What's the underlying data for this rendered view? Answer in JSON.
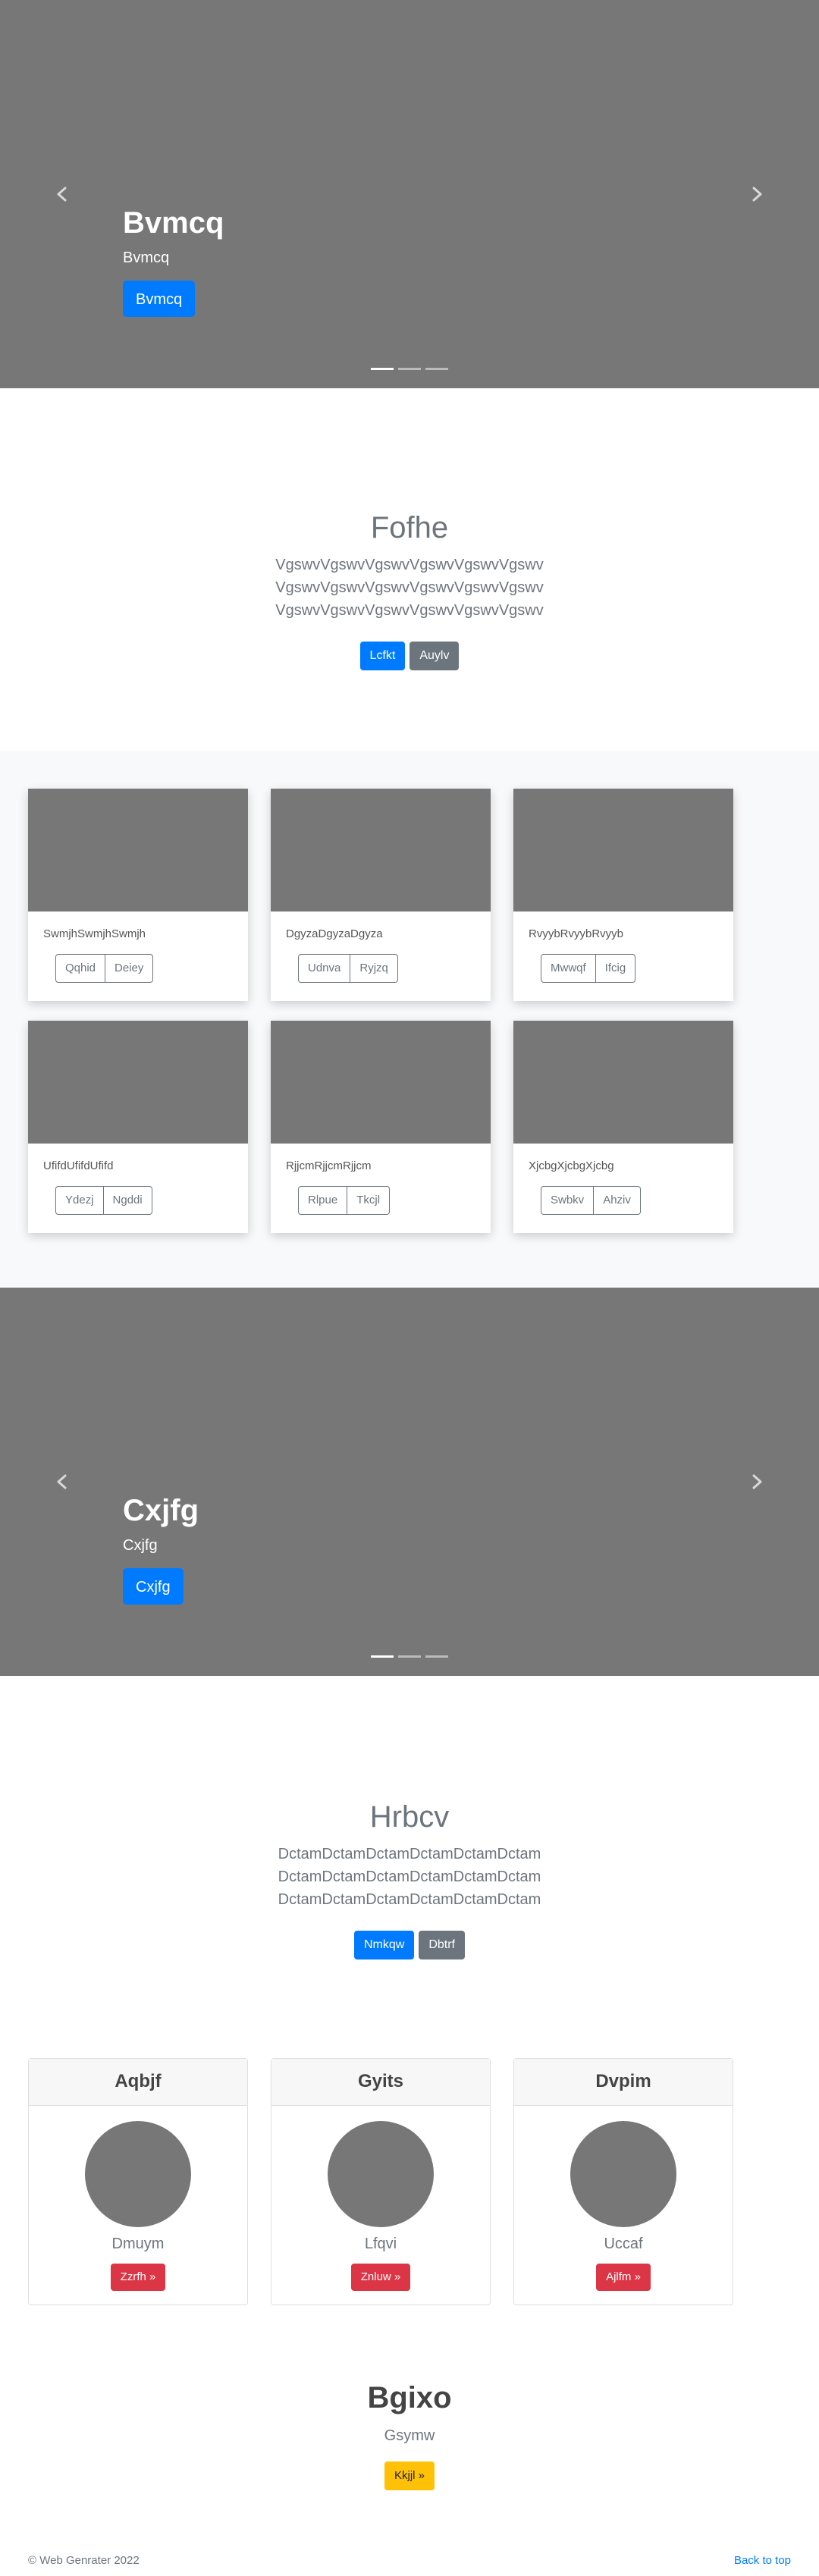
{
  "carousel1": {
    "title": "Bvmcq",
    "subtitle": "Bvmcq",
    "button_label": "Bvmcq",
    "indicator_count": 3,
    "active_indicator": 1
  },
  "intro1": {
    "title": "Fofhe",
    "lead_lines": [
      "VgswvVgswvVgswvVgswvVgswvVgswv",
      "VgswvVgswvVgswvVgswvVgswvVgswv",
      "VgswvVgswvVgswvVgswvVgswvVgswv"
    ],
    "primary_label": "Lcfkt",
    "secondary_label": "Auylv"
  },
  "album": {
    "cards": [
      {
        "text": "SwmjhSwmjhSwmjh",
        "btn1": "Qqhid",
        "btn2": "Deiey"
      },
      {
        "text": "DgyzaDgyzaDgyza",
        "btn1": "Udnva",
        "btn2": "Ryjzq"
      },
      {
        "text": "RvyybRvyybRvyyb",
        "btn1": "Mwwqf",
        "btn2": "Ifcig"
      },
      {
        "text": "UfifdUfifdUfifd",
        "btn1": "Ydezj",
        "btn2": "Ngddi"
      },
      {
        "text": "RjjcmRjjcmRjjcm",
        "btn1": "Rlpue",
        "btn2": "Tkcjl"
      },
      {
        "text": "XjcbgXjcbgXjcbg",
        "btn1": "Swbkv",
        "btn2": "Ahziv"
      }
    ]
  },
  "carousel2": {
    "title": "Cxjfg",
    "subtitle": "Cxjfg",
    "button_label": "Cxjfg",
    "indicator_count": 3,
    "active_indicator": 1
  },
  "intro2": {
    "title": "Hrbcv",
    "lead_lines": [
      "DctamDctamDctamDctamDctamDctam",
      "DctamDctamDctamDctamDctamDctam",
      "DctamDctamDctamDctamDctamDctam"
    ],
    "primary_label": "Nmkqw",
    "secondary_label": "Dbtrf"
  },
  "pricing": {
    "cards": [
      {
        "header": "Aqbjf",
        "name": "Dmuym",
        "button": "Zzrfh »"
      },
      {
        "header": "Gyits",
        "name": "Lfqvi",
        "button": "Znluw »"
      },
      {
        "header": "Dvpim",
        "name": "Uccaf",
        "button": "Ajlfm »"
      }
    ]
  },
  "cta": {
    "title": "Bgixo",
    "subtitle": "Gsymw",
    "button": "Kkjjl »"
  },
  "footer": {
    "copyright": "© Web Genrater 2022",
    "back_to_top": "Back to top"
  },
  "colors": {
    "primary": "#007bff",
    "secondary": "#6c757d",
    "danger": "#dc3545",
    "warning": "#ffc107",
    "placeholder": "#777777"
  }
}
